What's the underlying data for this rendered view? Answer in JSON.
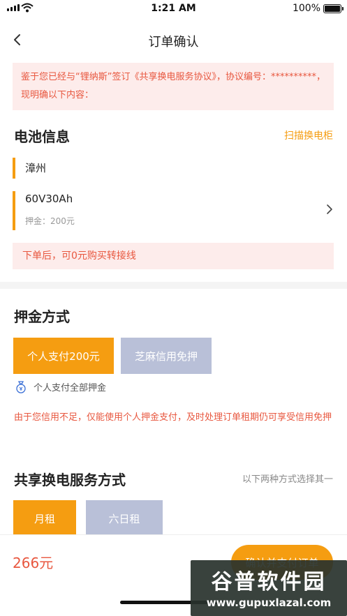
{
  "status_bar": {
    "time": "1:21 AM",
    "battery_pct": "100%"
  },
  "nav": {
    "title": "订单确认"
  },
  "notice": {
    "text": "鉴于您已经与“锂纳斯”签订《共享换电服务协议》，协议编号：**********，现明确以下内容："
  },
  "battery_info": {
    "title": "电池信息",
    "scan_link": "扫描换电柜",
    "city": "漳州",
    "model": "60V30Ah",
    "deposit": "押金：200元",
    "tip": "下单后，可0元购买转接线"
  },
  "deposit_method": {
    "title": "押金方式",
    "options": [
      {
        "label": "个人支付200元",
        "selected": true
      },
      {
        "label": "芝麻信用免押",
        "selected": false
      }
    ],
    "hint": "个人支付全部押金",
    "warning": "由于您信用不足，仅能使用个人押金支付，及时处理订单租期仍可享受信用免押"
  },
  "service_method": {
    "title": "共享换电服务方式",
    "note": "以下两种方式选择其一",
    "options": [
      {
        "label": "月租",
        "selected": true
      },
      {
        "label": "六日租",
        "selected": false
      }
    ]
  },
  "footer": {
    "price": "266元",
    "pay_button": "确认并支付订单"
  },
  "watermark": {
    "title": "谷普软件园",
    "url": "www.gupuxlazal.com"
  },
  "colors": {
    "accent": "#f59d11",
    "warning": "#e8573f",
    "inactive": "#b9c0d8"
  }
}
